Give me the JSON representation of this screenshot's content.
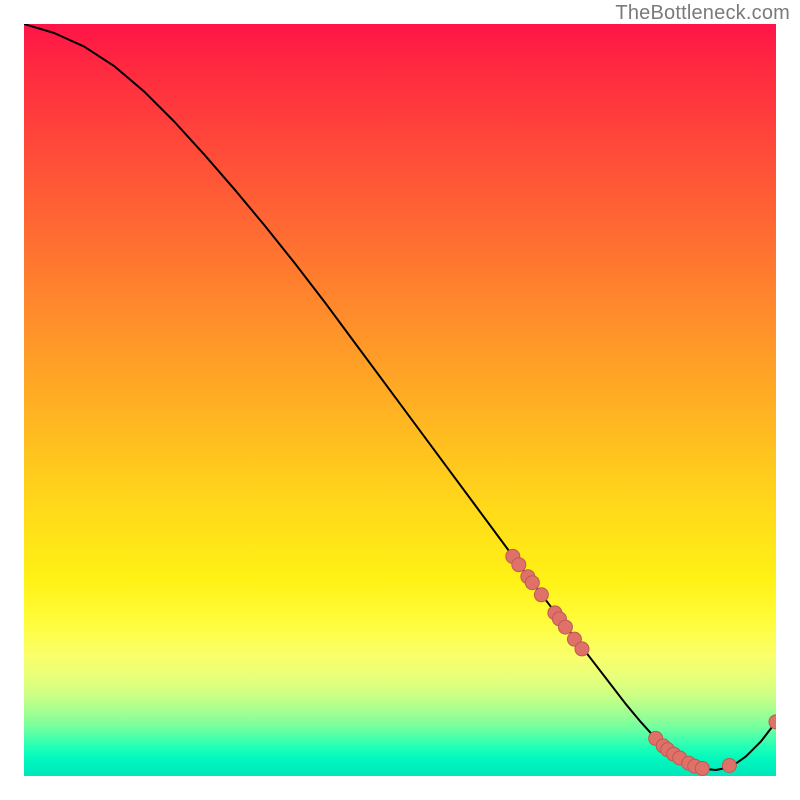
{
  "watermark": {
    "text": "TheBottleneck.com"
  },
  "colors": {
    "curve": "#000000",
    "marker_fill": "#e07168",
    "marker_stroke": "#bd5a52"
  },
  "chart_data": {
    "type": "line",
    "title": "",
    "xlabel": "",
    "ylabel": "",
    "xlim": [
      0,
      100
    ],
    "ylim": [
      0,
      100
    ],
    "grid": false,
    "legend": false,
    "series": [
      {
        "name": "bottleneck-curve",
        "x": [
          0,
          4,
          8,
          12,
          16,
          20,
          24,
          28,
          32,
          36,
          40,
          44,
          48,
          52,
          56,
          60,
          64,
          68,
          70,
          72,
          74,
          76,
          78,
          80,
          82,
          84,
          86,
          88,
          90,
          92,
          94,
          96,
          98,
          100
        ],
        "y": [
          100,
          98.8,
          97.0,
          94.4,
          91.0,
          87.0,
          82.6,
          78.0,
          73.2,
          68.2,
          63.0,
          57.6,
          52.2,
          46.8,
          41.4,
          36.0,
          30.6,
          25.2,
          22.6,
          20.0,
          17.4,
          14.8,
          12.2,
          9.6,
          7.2,
          5.0,
          3.2,
          1.8,
          1.0,
          0.8,
          1.2,
          2.6,
          4.6,
          7.2
        ]
      }
    ],
    "markers": [
      {
        "name": "highlight-cluster-descending",
        "x": [
          65.0,
          65.8,
          67.0,
          67.6,
          68.8,
          70.6,
          71.2,
          72.0,
          73.2,
          74.2
        ],
        "y": [
          29.2,
          28.1,
          26.5,
          25.7,
          24.1,
          21.7,
          20.9,
          19.8,
          18.2,
          16.9
        ]
      },
      {
        "name": "highlight-cluster-bottom",
        "x": [
          84.0,
          85.0,
          85.6,
          86.4,
          87.2,
          88.4,
          89.2,
          90.2,
          93.8
        ],
        "y": [
          5.0,
          4.0,
          3.5,
          2.9,
          2.4,
          1.7,
          1.3,
          1.0,
          1.4
        ]
      },
      {
        "name": "highlight-end",
        "x": [
          100.0
        ],
        "y": [
          7.2
        ]
      }
    ]
  }
}
